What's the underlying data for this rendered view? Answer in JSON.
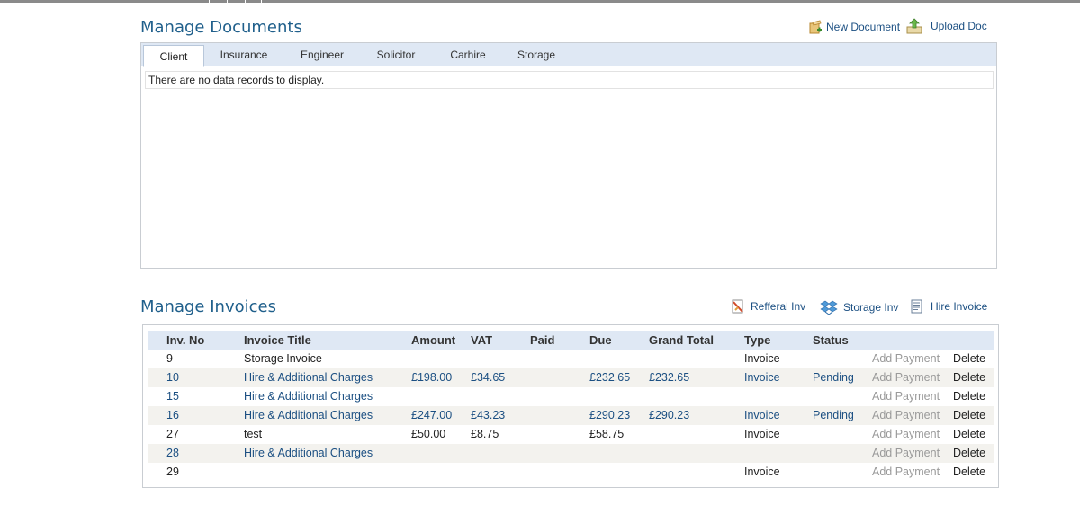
{
  "documents": {
    "title": "Manage Documents",
    "actions": {
      "new_document": "New Document",
      "upload_doc": "Upload Doc"
    },
    "tabs": [
      "Client",
      "Insurance",
      "Engineer",
      "Solicitor",
      "Carhire",
      "Storage"
    ],
    "active_tab": "Client",
    "empty_message": "There are no data records to display."
  },
  "invoices": {
    "title": "Manage Invoices",
    "actions": {
      "refferal_inv": "Refferal Inv",
      "storage_inv": "Storage Inv",
      "hire_invoice": "Hire Invoice"
    },
    "columns": {
      "no": "Inv. No",
      "title": "Invoice Title",
      "amount": "Amount",
      "vat": "VAT",
      "paid": "Paid",
      "due": "Due",
      "grand": "Grand Total",
      "type": "Type",
      "status": "Status"
    },
    "rows": [
      {
        "no": "9",
        "title": "Storage Invoice",
        "amount": "",
        "vat": "",
        "paid": "",
        "due": "",
        "grand": "",
        "type": "Invoice",
        "status": "",
        "pay": "Add Payment",
        "del": "Delete"
      },
      {
        "no": "10",
        "title": "Hire & Additional Charges",
        "amount": "£198.00",
        "vat": "£34.65",
        "paid": "",
        "due": "£232.65",
        "grand": "£232.65",
        "type": "Invoice",
        "status": "Pending",
        "pay": "Add Payment",
        "del": "Delete"
      },
      {
        "no": "15",
        "title": "Hire & Additional Charges",
        "amount": "",
        "vat": "",
        "paid": "",
        "due": "",
        "grand": "",
        "type": "",
        "status": "",
        "pay": "Add Payment",
        "del": "Delete"
      },
      {
        "no": "16",
        "title": "Hire & Additional Charges",
        "amount": "£247.00",
        "vat": "£43.23",
        "paid": "",
        "due": "£290.23",
        "grand": "£290.23",
        "type": "Invoice",
        "status": "Pending",
        "pay": "Add Payment",
        "del": "Delete"
      },
      {
        "no": "27",
        "title": "test",
        "amount": "£50.00",
        "vat": "£8.75",
        "paid": "",
        "due": "£58.75",
        "grand": "",
        "type": "Invoice",
        "status": "",
        "pay": "Add Payment",
        "del": "Delete"
      },
      {
        "no": "28",
        "title": "Hire & Additional Charges",
        "amount": "",
        "vat": "",
        "paid": "",
        "due": "",
        "grand": "",
        "type": "",
        "status": "",
        "pay": "Add Payment",
        "del": "Delete"
      },
      {
        "no": "29",
        "title": "",
        "amount": "",
        "vat": "",
        "paid": "",
        "due": "",
        "grand": "",
        "type": "Invoice",
        "status": "",
        "pay": "Add Payment",
        "del": "Delete"
      }
    ]
  },
  "colors": {
    "title": "#1f5f8b",
    "link": "#1b4f82",
    "header_bg": "#dfe8f4",
    "alt_row": "#f3f2ee",
    "muted": "#9a9a9a"
  }
}
